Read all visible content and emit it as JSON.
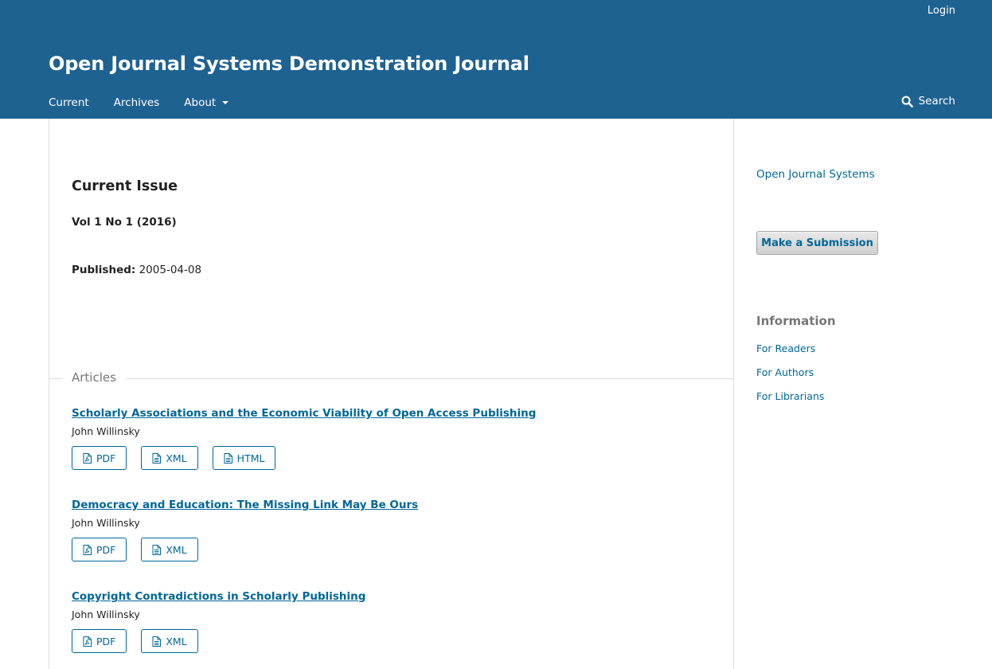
{
  "header": {
    "login": "Login",
    "site_title": "Open Journal Systems Demonstration Journal",
    "nav": [
      "Current",
      "Archives",
      "About"
    ],
    "search": "Search"
  },
  "main": {
    "page_heading": "Current Issue",
    "issue": "Vol 1 No 1 (2016)",
    "published_label": "Published:",
    "published_date": "2005-04-08",
    "section": "Articles",
    "articles": [
      {
        "title": "Scholarly Associations and the Economic Viability of Open Access Publishing",
        "author": "John Willinsky",
        "galleys": [
          "PDF",
          "XML",
          "HTML"
        ]
      },
      {
        "title": "Democracy and Education: The Missing Link May Be Ours",
        "author": "John Willinsky",
        "galleys": [
          "PDF",
          "XML"
        ]
      },
      {
        "title": "Copyright Contradictions in Scholarly Publishing",
        "author": "John Willinsky",
        "galleys": [
          "PDF",
          "XML"
        ]
      }
    ]
  },
  "sidebar": {
    "ojs_link": "Open Journal Systems",
    "submit": "Make a Submission",
    "info_heading": "Information",
    "info_links": [
      "For Readers",
      "For Authors",
      "For Librarians"
    ]
  },
  "colors": {
    "header_bg": "#1e6292",
    "link": "#006798"
  },
  "icons": {
    "search": "search-icon",
    "pdf": "file-pdf-icon",
    "xml": "file-text-icon",
    "html": "file-text-icon",
    "dropdown": "caret-down-icon"
  }
}
